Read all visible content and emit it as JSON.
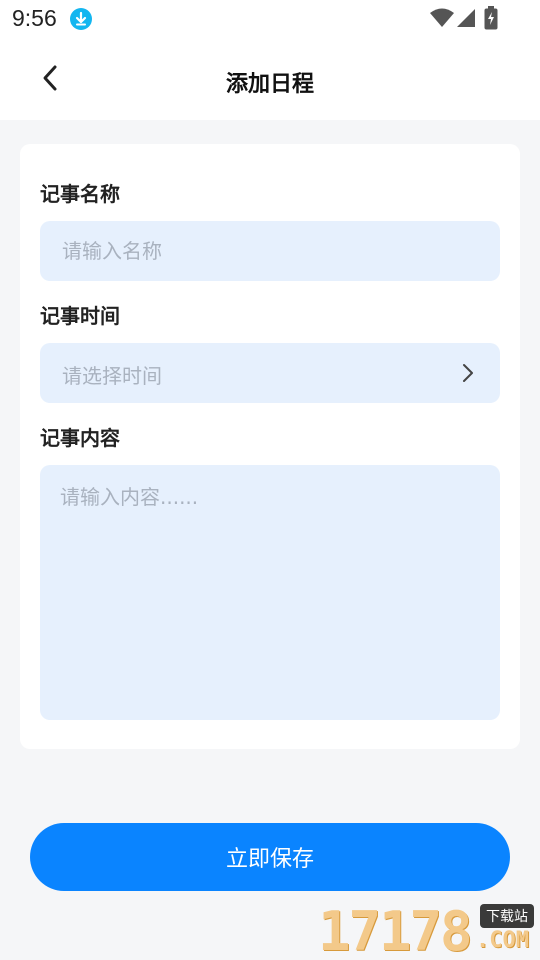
{
  "status_bar": {
    "time": "9:56",
    "icons": [
      "download-icon",
      "wifi-icon",
      "signal-icon",
      "battery-icon"
    ]
  },
  "header": {
    "back_icon": "chevron-left-icon",
    "title": "添加日程"
  },
  "form": {
    "name": {
      "label": "记事名称",
      "placeholder": "请输入名称",
      "value": ""
    },
    "time": {
      "label": "记事时间",
      "placeholder": "请选择时间",
      "value": "",
      "icon": "chevron-right-icon"
    },
    "content": {
      "label": "记事内容",
      "placeholder": "请输入内容......",
      "value": ""
    }
  },
  "actions": {
    "save_label": "立即保存"
  },
  "watermark": {
    "number": "17178",
    "badge": "下载站",
    "domain": ".COM"
  },
  "colors": {
    "primary": "#0a84ff",
    "field_bg": "#e6f0fd",
    "page_bg": "#f5f6f8",
    "placeholder": "#a9b2bf"
  }
}
